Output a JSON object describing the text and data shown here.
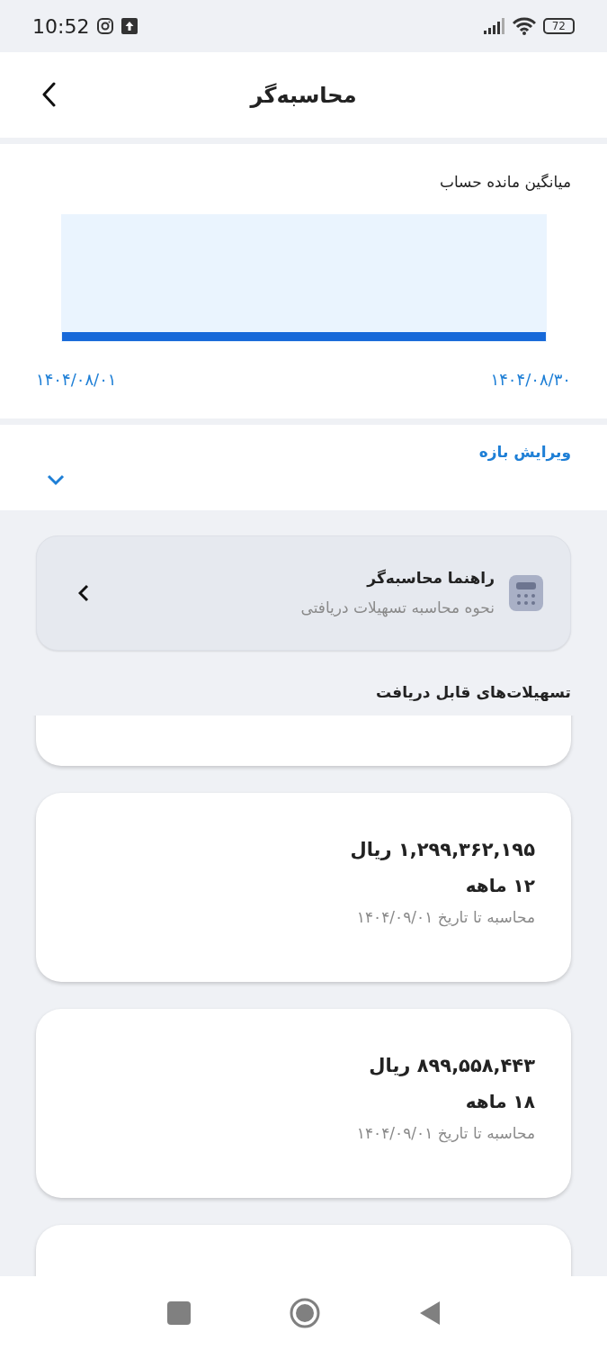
{
  "status_bar": {
    "time": "10:52",
    "battery": "72"
  },
  "header": {
    "title": "محاسبه‌گر"
  },
  "balance_chart": {
    "title": "میانگین مانده حساب",
    "axis_labels": [
      "۱۴۰۴/۰۸/۳۰",
      "۱۴۰۴/۰۸/۰۱"
    ]
  },
  "range_editor": {
    "label": "ویرایش بازه",
    "expanded": false
  },
  "guide": {
    "title": "راهنما محاسبه‌گر",
    "subtitle": "نحوه محاسبه تسهیلات دریافتی"
  },
  "loans": {
    "heading": "تسهیلات‌های قابل دریافت",
    "cards": [
      {
        "kind": "partial"
      },
      {
        "kind": "full",
        "amount": "۱,۲۹۹,۳۶۲,۱۹۵ ریال",
        "term": "۱۲ ماهه",
        "note": "محاسبه تا تاریخ ۱۴۰۴/۰۹/۰۱"
      },
      {
        "kind": "full",
        "amount": "۸۹۹,۵۵۸,۴۴۳ ریال",
        "term": "۱۸ ماهه",
        "note": "محاسبه تا تاریخ ۱۴۰۴/۰۹/۰۱"
      },
      {
        "kind": "partial"
      }
    ]
  }
}
